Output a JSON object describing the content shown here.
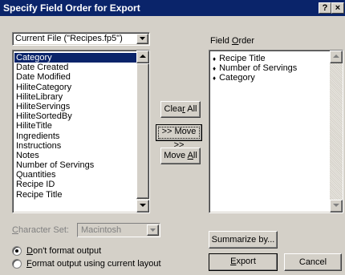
{
  "title": "Specify Field Order for Export",
  "title_buttons": {
    "help": "?",
    "close": "×"
  },
  "source_dropdown": {
    "value": "Current File (\"Recipes.fp5\")"
  },
  "fields": [
    "Category",
    "Date Created",
    "Date Modified",
    "HiliteCategory",
    "HiliteLibrary",
    "HiliteServings",
    "HiliteSortedBy",
    "HiliteTitle",
    "Ingredients",
    "Instructions",
    "Notes",
    "Number of Servings",
    "Quantities",
    "Recipe ID",
    "Recipe Title"
  ],
  "selected_field": "Category",
  "buttons": {
    "clear_all_pre": "Clea",
    "clear_all_ul": "r",
    "clear_all_post": " All",
    "move": ">> Move >>",
    "move_all_pre": "Move ",
    "move_all_ul": "A",
    "move_all_post": "ll",
    "summarize": "Summarize by...",
    "export_pre": "",
    "export_ul": "E",
    "export_post": "xport",
    "cancel": "Cancel"
  },
  "field_order": {
    "label_pre": "Field ",
    "label_ul": "O",
    "label_post": "rder",
    "items": [
      "Recipe Title",
      "Number of Servings",
      "Category"
    ],
    "bullet": "♦"
  },
  "character_set": {
    "label_pre": "",
    "label_ul": "C",
    "label_post": "haracter Set:",
    "value": "Macintosh"
  },
  "format_options": [
    {
      "pre": "",
      "ul": "D",
      "post": "on't format output",
      "checked": true
    },
    {
      "pre": "",
      "ul": "F",
      "post": "ormat output using current layout",
      "checked": false
    }
  ]
}
